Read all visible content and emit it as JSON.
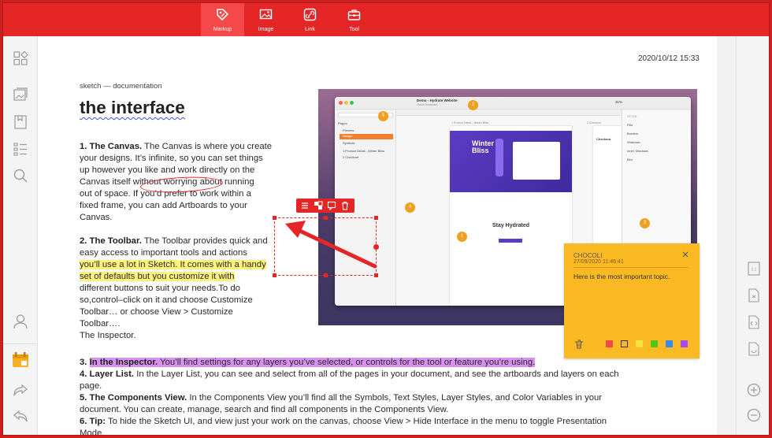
{
  "toolbar": {
    "tabs": [
      {
        "label": "Markup",
        "icon": "markup-tag-icon",
        "active": true
      },
      {
        "label": "Image",
        "icon": "image-icon",
        "active": false
      },
      {
        "label": "Link",
        "icon": "link-icon",
        "active": false
      },
      {
        "label": "Tool",
        "icon": "toolbox-icon",
        "active": false
      }
    ]
  },
  "markup_tools": [
    "eraser-icon",
    "strikethrough-icon",
    "underline-icon",
    "double-underline-icon",
    "pencil-icon",
    "text-box-icon",
    "note-list-icon",
    "shape-icon",
    "fill-bucket-icon"
  ],
  "page": {
    "datetime": "2020/10/12 15:33",
    "breadcrumb": "sketch — documentation",
    "title": "the interface",
    "p1_head": "1. The Canvas.",
    "p1_line1": " The Canvas is where you create",
    "p1_line2": "your designs. It’s infinite, so you can set things",
    "p1_line3": "up however you like and work directly on the",
    "p1_line4": "Canvas itself without worrying about running",
    "p1_line5": "out of space. If you’d prefer to work within a",
    "p1_line6": "fixed frame, you can add Artboards to your",
    "p1_line7": "Canvas.",
    "p2_head": "2. The Toolbar.",
    "p2_line1": " The Toolbar provides quick and",
    "p2_line2": "easy access to important tools and actions",
    "p2_hl1": "you’ll use a lot in Sketch. It comes with a handy",
    "p2_hl2": "set of defaults but you customize it with",
    "p2_line3": "different buttons to suit your needs.To do",
    "p2_line4": "so,control–click on it and choose Customize",
    "p2_line5": "Toolbar… or choose View > Customize",
    "p2_line6": "Toolbar….",
    "p2_line7": "The Inspector.",
    "p3_head": "In the Inspector.",
    "p3_num": "3. ",
    "p3_rest": " You’ll find settings for any layers you’ve selected, or controls for the tool or feature you’re using.",
    "p4_head": "4. Layer List.",
    "p4_text": " In the Layer List, you can see and select from all of the pages in your document, and see the artboards and layers on each",
    "p4_text2": "page.",
    "p5_head": "5. The Components View.",
    "p5_text": " In the Components View you’ll find all the Symbols, Text Styles, Layer Styles, and Color Variables in your",
    "p5_text2": "document. You can create, manage, search and find all components in the Components View.",
    "p6_head": "6. Tip:",
    "p6_text": " To hide the Sketch UI, and view just your work on the canvas, choose View > Hide Interface in the menu to toggle Presentation",
    "p6_text2": "Mode."
  },
  "screenshot": {
    "app_title": "Demo - Hydrate Website",
    "app_subtitle": "Cloud Document",
    "pages_label": "Pages",
    "page_items": [
      "Preview",
      "Design",
      "Symbols"
    ],
    "layer_items": [
      "1 Product Detail - Winter Bliss",
      "2 Checkout"
    ],
    "artboard_label_1": "1 Product Detail – Winter Bliss",
    "artboard_label_2": "2 Checkout",
    "hero_text": "Winter Bliss",
    "section_title": "Stay Hydrated",
    "checkout_title": "Checkout",
    "zoom": "31%",
    "inspector_items": [
      "STYLE",
      "Fills",
      "Borders",
      "Shadows",
      "Inner Shadows",
      "Blur"
    ],
    "badges": [
      "1",
      "2",
      "3",
      "4",
      "5"
    ]
  },
  "note": {
    "title": "CHOCOLI",
    "date": "27/09/2020 11:46:41",
    "body": "Here is the most important topic.",
    "colors": [
      "#f04747",
      "#fbb924",
      "#f5e33a",
      "#52c41a",
      "#3b8beb",
      "#a54bf0"
    ]
  },
  "colors": {
    "accent": "#e52626",
    "highlight_yellow": "#fff27a",
    "highlight_purple": "#d890ee",
    "note": "#fbb924"
  }
}
